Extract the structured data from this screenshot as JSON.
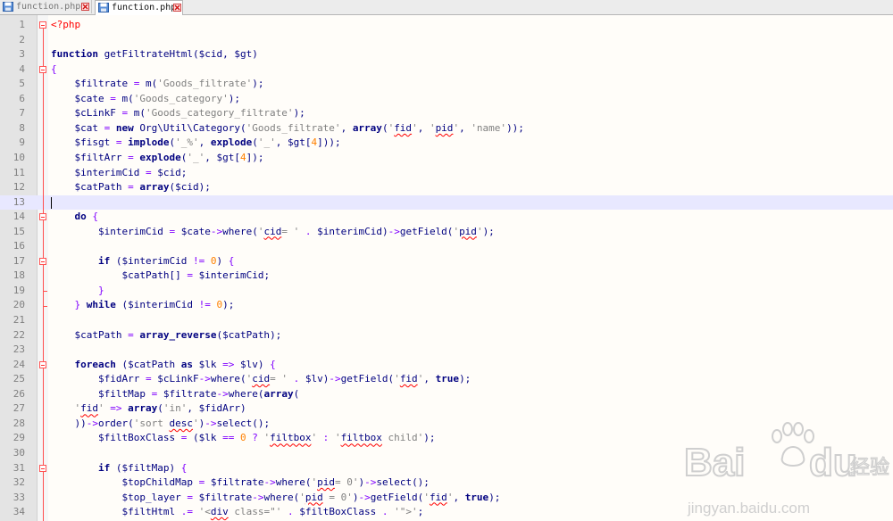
{
  "tabs": [
    {
      "label": "function.php",
      "active": false
    },
    {
      "label": "function.php",
      "active": true
    }
  ],
  "editor": {
    "current_line": 13,
    "lines": [
      {
        "n": "1",
        "tokens": [
          [
            "tag",
            "<?php"
          ]
        ]
      },
      {
        "n": "2",
        "tokens": []
      },
      {
        "n": "3",
        "tokens": [
          [
            "kw",
            "function"
          ],
          [
            "txt",
            " getFiltrateHtml("
          ],
          [
            "var",
            "$cid"
          ],
          [
            "txt",
            ", "
          ],
          [
            "var",
            "$gt"
          ],
          [
            "txt",
            ")"
          ]
        ]
      },
      {
        "n": "4",
        "tokens": [
          [
            "op",
            "{"
          ]
        ]
      },
      {
        "n": "5",
        "tokens": [
          [
            "txt",
            "    "
          ],
          [
            "var",
            "$filtrate"
          ],
          [
            "op",
            " = "
          ],
          [
            "txt",
            "m("
          ],
          [
            "str",
            "'Goods_filtrate'"
          ],
          [
            "txt",
            ");"
          ]
        ]
      },
      {
        "n": "6",
        "tokens": [
          [
            "txt",
            "    "
          ],
          [
            "var",
            "$cate"
          ],
          [
            "op",
            " = "
          ],
          [
            "txt",
            "m("
          ],
          [
            "str",
            "'Goods_category'"
          ],
          [
            "txt",
            ");"
          ]
        ]
      },
      {
        "n": "7",
        "tokens": [
          [
            "txt",
            "    "
          ],
          [
            "var",
            "$cLinkF"
          ],
          [
            "op",
            " = "
          ],
          [
            "txt",
            "m("
          ],
          [
            "str",
            "'Goods_category_filtrate'"
          ],
          [
            "txt",
            ");"
          ]
        ]
      },
      {
        "n": "8",
        "tokens": [
          [
            "txt",
            "    "
          ],
          [
            "var",
            "$cat"
          ],
          [
            "op",
            " = "
          ],
          [
            "kw",
            "new"
          ],
          [
            "txt",
            " Org\\Util\\Category("
          ],
          [
            "str",
            "'Goods_filtrate'"
          ],
          [
            "txt",
            ", "
          ],
          [
            "kw",
            "array"
          ],
          [
            "txt",
            "("
          ],
          [
            "str",
            "'"
          ],
          [
            "err",
            "fid"
          ],
          [
            "str",
            "'"
          ],
          [
            "txt",
            ", "
          ],
          [
            "str",
            "'"
          ],
          [
            "err",
            "pid"
          ],
          [
            "str",
            "'"
          ],
          [
            "txt",
            ", "
          ],
          [
            "str",
            "'name'"
          ],
          [
            "txt",
            "));"
          ]
        ]
      },
      {
        "n": "9",
        "tokens": [
          [
            "txt",
            "    "
          ],
          [
            "var",
            "$fisgt"
          ],
          [
            "op",
            " = "
          ],
          [
            "kw",
            "implode"
          ],
          [
            "txt",
            "("
          ],
          [
            "str",
            "'_%'"
          ],
          [
            "txt",
            ", "
          ],
          [
            "kw",
            "explode"
          ],
          [
            "txt",
            "("
          ],
          [
            "str",
            "'_'"
          ],
          [
            "txt",
            ", "
          ],
          [
            "var",
            "$gt"
          ],
          [
            "txt",
            "["
          ],
          [
            "num",
            "4"
          ],
          [
            "txt",
            "]));"
          ]
        ]
      },
      {
        "n": "10",
        "tokens": [
          [
            "txt",
            "    "
          ],
          [
            "var",
            "$filtArr"
          ],
          [
            "op",
            " = "
          ],
          [
            "kw",
            "explode"
          ],
          [
            "txt",
            "("
          ],
          [
            "str",
            "'_'"
          ],
          [
            "txt",
            ", "
          ],
          [
            "var",
            "$gt"
          ],
          [
            "txt",
            "["
          ],
          [
            "num",
            "4"
          ],
          [
            "txt",
            "]);"
          ]
        ]
      },
      {
        "n": "11",
        "tokens": [
          [
            "txt",
            "    "
          ],
          [
            "var",
            "$interimCid"
          ],
          [
            "op",
            " = "
          ],
          [
            "var",
            "$cid"
          ],
          [
            "txt",
            ";"
          ]
        ]
      },
      {
        "n": "12",
        "tokens": [
          [
            "txt",
            "    "
          ],
          [
            "var",
            "$catPath"
          ],
          [
            "op",
            " = "
          ],
          [
            "kw",
            "array"
          ],
          [
            "txt",
            "("
          ],
          [
            "var",
            "$cid"
          ],
          [
            "txt",
            ");"
          ]
        ]
      },
      {
        "n": "13",
        "tokens": []
      },
      {
        "n": "14",
        "tokens": [
          [
            "txt",
            "    "
          ],
          [
            "kw",
            "do"
          ],
          [
            "txt",
            " "
          ],
          [
            "op",
            "{"
          ]
        ]
      },
      {
        "n": "15",
        "tokens": [
          [
            "txt",
            "        "
          ],
          [
            "var",
            "$interimCid"
          ],
          [
            "op",
            " = "
          ],
          [
            "var",
            "$cate"
          ],
          [
            "op",
            "->"
          ],
          [
            "txt",
            "where("
          ],
          [
            "str",
            "'"
          ],
          [
            "err",
            "cid"
          ],
          [
            "str",
            "= '"
          ],
          [
            "op",
            " . "
          ],
          [
            "var",
            "$interimCid"
          ],
          [
            "txt",
            ")"
          ],
          [
            "op",
            "->"
          ],
          [
            "txt",
            "getField("
          ],
          [
            "str",
            "'"
          ],
          [
            "err",
            "pid"
          ],
          [
            "str",
            "'"
          ],
          [
            "txt",
            ");"
          ]
        ]
      },
      {
        "n": "16",
        "tokens": []
      },
      {
        "n": "17",
        "tokens": [
          [
            "txt",
            "        "
          ],
          [
            "kw",
            "if"
          ],
          [
            "txt",
            " ("
          ],
          [
            "var",
            "$interimCid"
          ],
          [
            "op",
            " != "
          ],
          [
            "num",
            "0"
          ],
          [
            "txt",
            ") "
          ],
          [
            "op",
            "{"
          ]
        ]
      },
      {
        "n": "18",
        "tokens": [
          [
            "txt",
            "            "
          ],
          [
            "var",
            "$catPath[]"
          ],
          [
            "op",
            " = "
          ],
          [
            "var",
            "$interimCid"
          ],
          [
            "txt",
            ";"
          ]
        ]
      },
      {
        "n": "19",
        "tokens": [
          [
            "txt",
            "        "
          ],
          [
            "op",
            "}"
          ]
        ]
      },
      {
        "n": "20",
        "tokens": [
          [
            "txt",
            "    "
          ],
          [
            "op",
            "}"
          ],
          [
            "txt",
            " "
          ],
          [
            "kw",
            "while"
          ],
          [
            "txt",
            " ("
          ],
          [
            "var",
            "$interimCid"
          ],
          [
            "op",
            " != "
          ],
          [
            "num",
            "0"
          ],
          [
            "txt",
            ");"
          ]
        ]
      },
      {
        "n": "21",
        "tokens": []
      },
      {
        "n": "22",
        "tokens": [
          [
            "txt",
            "    "
          ],
          [
            "var",
            "$catPath"
          ],
          [
            "op",
            " = "
          ],
          [
            "kw",
            "array_reverse"
          ],
          [
            "txt",
            "("
          ],
          [
            "var",
            "$catPath"
          ],
          [
            "txt",
            ");"
          ]
        ]
      },
      {
        "n": "23",
        "tokens": []
      },
      {
        "n": "24",
        "tokens": [
          [
            "txt",
            "    "
          ],
          [
            "kw",
            "foreach"
          ],
          [
            "txt",
            " ("
          ],
          [
            "var",
            "$catPath"
          ],
          [
            "txt",
            " "
          ],
          [
            "kw",
            "as"
          ],
          [
            "txt",
            " "
          ],
          [
            "var",
            "$lk"
          ],
          [
            "op",
            " => "
          ],
          [
            "var",
            "$lv"
          ],
          [
            "txt",
            ") "
          ],
          [
            "op",
            "{"
          ]
        ]
      },
      {
        "n": "25",
        "tokens": [
          [
            "txt",
            "        "
          ],
          [
            "var",
            "$fidArr"
          ],
          [
            "op",
            " = "
          ],
          [
            "var",
            "$cLinkF"
          ],
          [
            "op",
            "->"
          ],
          [
            "txt",
            "where("
          ],
          [
            "str",
            "'"
          ],
          [
            "err",
            "cid"
          ],
          [
            "str",
            "= '"
          ],
          [
            "op",
            " . "
          ],
          [
            "var",
            "$lv"
          ],
          [
            "txt",
            ")"
          ],
          [
            "op",
            "->"
          ],
          [
            "txt",
            "getField("
          ],
          [
            "str",
            "'"
          ],
          [
            "err",
            "fid"
          ],
          [
            "str",
            "'"
          ],
          [
            "txt",
            ", "
          ],
          [
            "kw",
            "true"
          ],
          [
            "txt",
            ");"
          ]
        ]
      },
      {
        "n": "26",
        "tokens": [
          [
            "txt",
            "        "
          ],
          [
            "var",
            "$filtMap"
          ],
          [
            "op",
            " = "
          ],
          [
            "var",
            "$filtrate"
          ],
          [
            "op",
            "->"
          ],
          [
            "txt",
            "where("
          ],
          [
            "kw",
            "array"
          ],
          [
            "txt",
            "("
          ]
        ]
      },
      {
        "n": "27",
        "tokens": [
          [
            "txt",
            "    "
          ],
          [
            "str",
            "'"
          ],
          [
            "err",
            "fid"
          ],
          [
            "str",
            "'"
          ],
          [
            "op",
            " => "
          ],
          [
            "kw",
            "array"
          ],
          [
            "txt",
            "("
          ],
          [
            "str",
            "'in'"
          ],
          [
            "txt",
            ", "
          ],
          [
            "var",
            "$fidArr"
          ],
          [
            "txt",
            ")"
          ]
        ]
      },
      {
        "n": "28",
        "tokens": [
          [
            "txt",
            "    ))"
          ],
          [
            "op",
            "->"
          ],
          [
            "txt",
            "order("
          ],
          [
            "str",
            "'sort "
          ],
          [
            "err",
            "desc"
          ],
          [
            "str",
            "'"
          ],
          [
            "txt",
            ")"
          ],
          [
            "op",
            "->"
          ],
          [
            "txt",
            "select();"
          ]
        ]
      },
      {
        "n": "29",
        "tokens": [
          [
            "txt",
            "        "
          ],
          [
            "var",
            "$filtBoxClass"
          ],
          [
            "op",
            " = "
          ],
          [
            "txt",
            "("
          ],
          [
            "var",
            "$lk"
          ],
          [
            "op",
            " == "
          ],
          [
            "num",
            "0"
          ],
          [
            "op",
            " ? "
          ],
          [
            "str",
            "'"
          ],
          [
            "err",
            "filtbox"
          ],
          [
            "str",
            "'"
          ],
          [
            "op",
            " : "
          ],
          [
            "str",
            "'"
          ],
          [
            "err",
            "filtbox"
          ],
          [
            "str",
            " child'"
          ],
          [
            "txt",
            ");"
          ]
        ]
      },
      {
        "n": "30",
        "tokens": []
      },
      {
        "n": "31",
        "tokens": [
          [
            "txt",
            "        "
          ],
          [
            "kw",
            "if"
          ],
          [
            "txt",
            " ("
          ],
          [
            "var",
            "$filtMap"
          ],
          [
            "txt",
            ") "
          ],
          [
            "op",
            "{"
          ]
        ]
      },
      {
        "n": "32",
        "tokens": [
          [
            "txt",
            "            "
          ],
          [
            "var",
            "$topChildMap"
          ],
          [
            "op",
            " = "
          ],
          [
            "var",
            "$filtrate"
          ],
          [
            "op",
            "->"
          ],
          [
            "txt",
            "where("
          ],
          [
            "str",
            "'"
          ],
          [
            "err",
            "pid"
          ],
          [
            "str",
            "= 0'"
          ],
          [
            "txt",
            ")"
          ],
          [
            "op",
            "->"
          ],
          [
            "txt",
            "select();"
          ]
        ]
      },
      {
        "n": "33",
        "tokens": [
          [
            "txt",
            "            "
          ],
          [
            "var",
            "$top_layer"
          ],
          [
            "op",
            " = "
          ],
          [
            "var",
            "$filtrate"
          ],
          [
            "op",
            "->"
          ],
          [
            "txt",
            "where("
          ],
          [
            "str",
            "'"
          ],
          [
            "err",
            "pid"
          ],
          [
            "str",
            " = 0'"
          ],
          [
            "txt",
            ")"
          ],
          [
            "op",
            "->"
          ],
          [
            "txt",
            "getField("
          ],
          [
            "str",
            "'"
          ],
          [
            "err",
            "fid"
          ],
          [
            "str",
            "'"
          ],
          [
            "txt",
            ", "
          ],
          [
            "kw",
            "true"
          ],
          [
            "txt",
            ");"
          ]
        ]
      },
      {
        "n": "34",
        "tokens": [
          [
            "txt",
            "            "
          ],
          [
            "var",
            "$filtHtml"
          ],
          [
            "op",
            " .= "
          ],
          [
            "str",
            "'<"
          ],
          [
            "err",
            "div"
          ],
          [
            "str",
            " class=\"'"
          ],
          [
            "op",
            " . "
          ],
          [
            "var",
            "$filtBoxClass"
          ],
          [
            "op",
            " . "
          ],
          [
            "str",
            "'\">'"
          ],
          [
            "txt",
            ";"
          ]
        ]
      }
    ]
  },
  "watermark": {
    "brand": "Bai",
    "brand2": "du",
    "cn": "经验",
    "url": "jingyan.baidu.com"
  }
}
